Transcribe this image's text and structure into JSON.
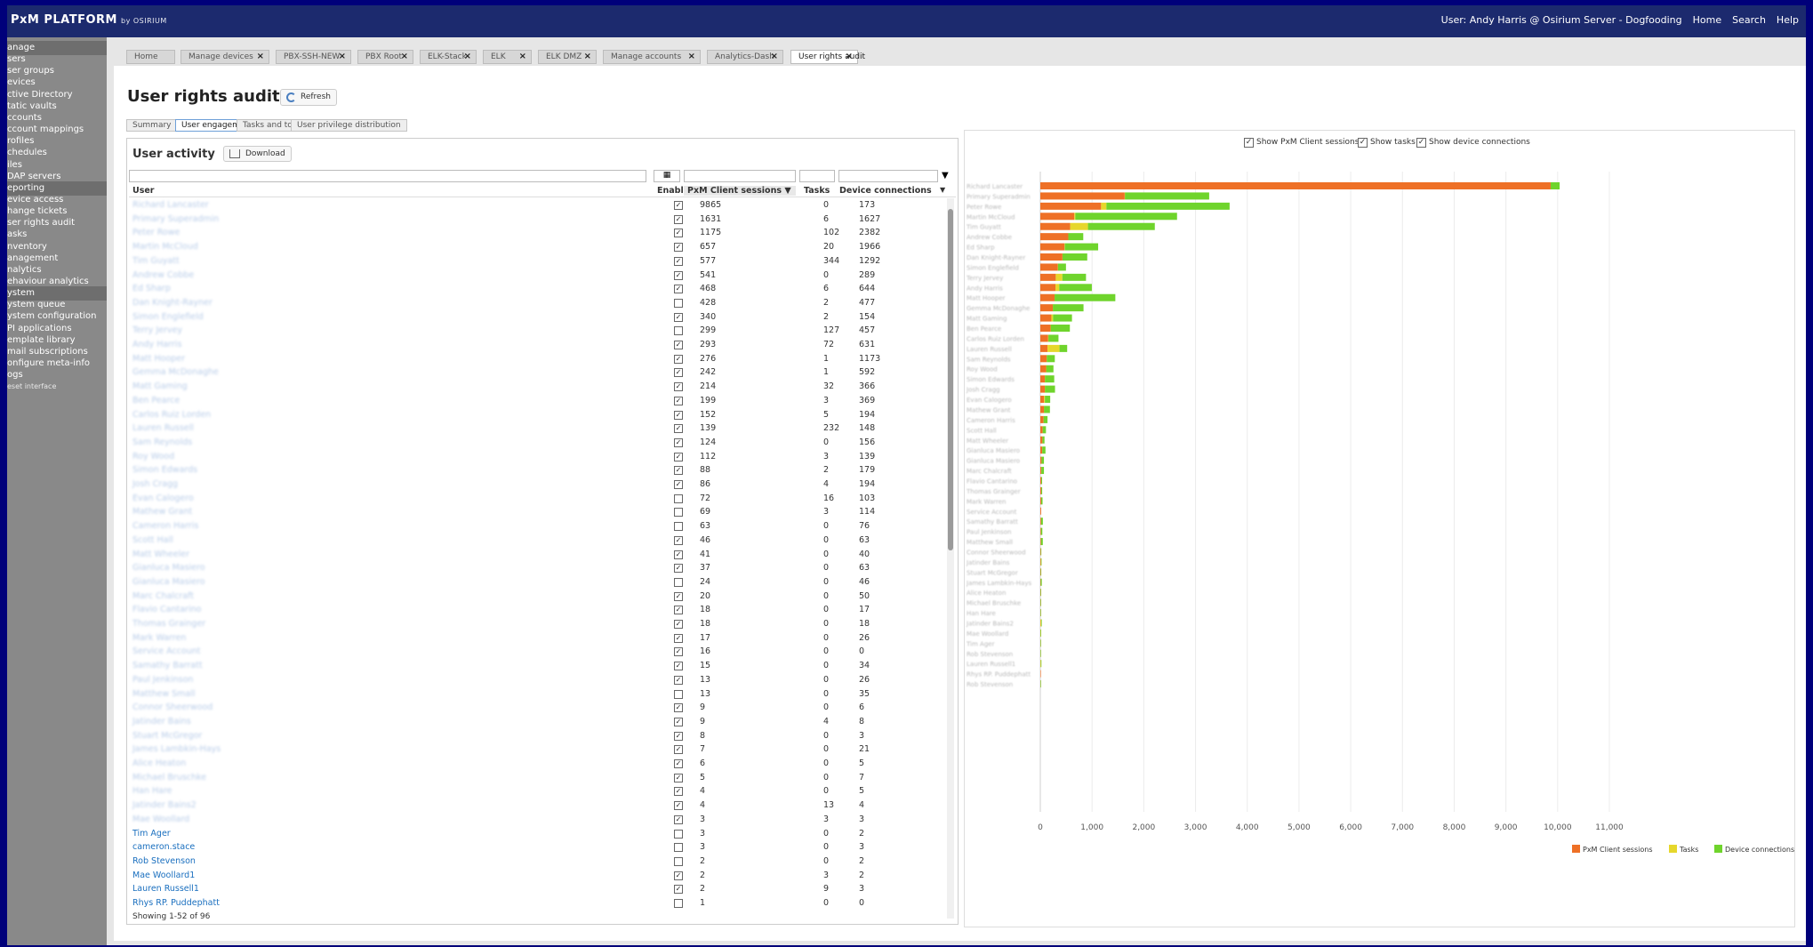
{
  "topbar": {
    "brand": "PxM PLATFORM",
    "brand_sub": "by OSIRIUM",
    "user": "User: Andy Harris @ Osirium Server - Dogfooding",
    "home": "Home",
    "search": "Search",
    "help": "Help"
  },
  "sidebar": [
    {
      "label": "anage",
      "type": "section"
    },
    {
      "label": "sers",
      "arrow": true
    },
    {
      "label": "ser groups",
      "arrow": true
    },
    {
      "label": "evices",
      "arrow": true
    },
    {
      "label": "ctive Directory",
      "arrow": true
    },
    {
      "label": "tatic vaults",
      "arrow": true
    },
    {
      "label": "ccounts"
    },
    {
      "label": "ccount mappings",
      "arrow": true
    },
    {
      "label": "rofiles",
      "arrow": true
    },
    {
      "label": "chedules",
      "arrow": true
    },
    {
      "label": "iles"
    },
    {
      "label": "DAP servers",
      "arrow": true
    },
    {
      "label": "eporting",
      "type": "section"
    },
    {
      "label": "evice access"
    },
    {
      "label": "hange tickets"
    },
    {
      "label": "ser rights audit"
    },
    {
      "label": "asks"
    },
    {
      "label": "nventory"
    },
    {
      "label": "anagement"
    },
    {
      "label": "nalytics"
    },
    {
      "label": "ehaviour analytics"
    },
    {
      "label": "ystem",
      "type": "section"
    },
    {
      "label": "ystem queue",
      "arrow": true
    },
    {
      "label": "ystem configuration"
    },
    {
      "label": "PI applications"
    },
    {
      "label": "emplate library"
    },
    {
      "label": "mail subscriptions"
    },
    {
      "label": "onfigure meta-info"
    },
    {
      "label": "ogs"
    },
    {
      "label": "eset interface",
      "type": "small"
    }
  ],
  "tabs": [
    {
      "label": "Home",
      "closable": false
    },
    {
      "label": "Manage devices",
      "closable": true
    },
    {
      "label": "PBX-SSH-NEW",
      "closable": true
    },
    {
      "label": "PBX Root",
      "closable": true
    },
    {
      "label": "ELK-Stack",
      "closable": true
    },
    {
      "label": "ELK",
      "closable": true
    },
    {
      "label": "ELK DMZ",
      "closable": true
    },
    {
      "label": "Manage accounts",
      "closable": true
    },
    {
      "label": "Analytics-Dash",
      "closable": true
    },
    {
      "label": "User rights audit",
      "closable": true,
      "active": true
    }
  ],
  "page": {
    "title": "User rights audit",
    "refresh_label": "Refresh"
  },
  "subtabs": [
    {
      "label": "Summary"
    },
    {
      "label": "User engagement",
      "active": true
    },
    {
      "label": "Tasks and tools"
    },
    {
      "label": "User privilege distribution"
    }
  ],
  "activity": {
    "title": "User activity",
    "download_label": "Download",
    "showing": "Showing 1-52 of 96"
  },
  "columns": {
    "user": "User",
    "enabled": "Enabled",
    "sessions": "PxM Client sessions",
    "tasks": "Tasks",
    "device": "Device connections"
  },
  "rows": [
    {
      "user": "Richard Lancaster",
      "enabled": true,
      "sessions": 9865,
      "tasks": 0,
      "device": 173
    },
    {
      "user": "Primary Superadmin",
      "enabled": true,
      "sessions": 1631,
      "tasks": 6,
      "device": 1627
    },
    {
      "user": "Peter Rowe",
      "enabled": true,
      "sessions": 1175,
      "tasks": 102,
      "device": 2382
    },
    {
      "user": "Martin McCloud",
      "enabled": true,
      "sessions": 657,
      "tasks": 20,
      "device": 1966
    },
    {
      "user": "Tim Guyatt",
      "enabled": true,
      "sessions": 577,
      "tasks": 344,
      "device": 1292
    },
    {
      "user": "Andrew Cobbe",
      "enabled": true,
      "sessions": 541,
      "tasks": 0,
      "device": 289
    },
    {
      "user": "Ed Sharp",
      "enabled": true,
      "sessions": 468,
      "tasks": 6,
      "device": 644
    },
    {
      "user": "Dan Knight-Rayner",
      "enabled": false,
      "sessions": 428,
      "tasks": 2,
      "device": 477
    },
    {
      "user": "Simon Englefield",
      "enabled": true,
      "sessions": 340,
      "tasks": 2,
      "device": 154
    },
    {
      "user": "Terry Jervey",
      "enabled": false,
      "sessions": 299,
      "tasks": 127,
      "device": 457
    },
    {
      "user": "Andy Harris",
      "enabled": true,
      "sessions": 293,
      "tasks": 72,
      "device": 631
    },
    {
      "user": "Matt Hooper",
      "enabled": true,
      "sessions": 276,
      "tasks": 1,
      "device": 1173
    },
    {
      "user": "Gemma McDonaghe",
      "enabled": true,
      "sessions": 242,
      "tasks": 1,
      "device": 592
    },
    {
      "user": "Matt Gaming",
      "enabled": true,
      "sessions": 214,
      "tasks": 32,
      "device": 366
    },
    {
      "user": "Ben Pearce",
      "enabled": true,
      "sessions": 199,
      "tasks": 3,
      "device": 369
    },
    {
      "user": "Carlos Ruiz Lorden",
      "enabled": true,
      "sessions": 152,
      "tasks": 5,
      "device": 194
    },
    {
      "user": "Lauren Russell",
      "enabled": true,
      "sessions": 139,
      "tasks": 232,
      "device": 148
    },
    {
      "user": "Sam Reynolds",
      "enabled": true,
      "sessions": 124,
      "tasks": 0,
      "device": 156
    },
    {
      "user": "Roy Wood",
      "enabled": true,
      "sessions": 112,
      "tasks": 3,
      "device": 139
    },
    {
      "user": "Simon Edwards",
      "enabled": true,
      "sessions": 88,
      "tasks": 2,
      "device": 179
    },
    {
      "user": "Josh Cragg",
      "enabled": true,
      "sessions": 86,
      "tasks": 4,
      "device": 194
    },
    {
      "user": "Evan Calogero",
      "enabled": false,
      "sessions": 72,
      "tasks": 16,
      "device": 103
    },
    {
      "user": "Mathew Grant",
      "enabled": false,
      "sessions": 69,
      "tasks": 3,
      "device": 114
    },
    {
      "user": "Cameron Harris",
      "enabled": false,
      "sessions": 63,
      "tasks": 0,
      "device": 76
    },
    {
      "user": "Scott Hall",
      "enabled": true,
      "sessions": 46,
      "tasks": 0,
      "device": 63
    },
    {
      "user": "Matt Wheeler",
      "enabled": true,
      "sessions": 41,
      "tasks": 0,
      "device": 40
    },
    {
      "user": "Gianluca Masiero",
      "enabled": true,
      "sessions": 37,
      "tasks": 0,
      "device": 63
    },
    {
      "user": "Gianluca Masiero",
      "enabled": false,
      "sessions": 24,
      "tasks": 0,
      "device": 46
    },
    {
      "user": "Marc Chalcraft",
      "enabled": true,
      "sessions": 20,
      "tasks": 0,
      "device": 50
    },
    {
      "user": "Flavio Cantarino",
      "enabled": true,
      "sessions": 18,
      "tasks": 0,
      "device": 17
    },
    {
      "user": "Thomas Grainger",
      "enabled": true,
      "sessions": 18,
      "tasks": 0,
      "device": 18
    },
    {
      "user": "Mark Warren",
      "enabled": true,
      "sessions": 17,
      "tasks": 0,
      "device": 26
    },
    {
      "user": "Service Account",
      "enabled": true,
      "sessions": 16,
      "tasks": 0,
      "device": 0
    },
    {
      "user": "Samathy Barratt",
      "enabled": true,
      "sessions": 15,
      "tasks": 0,
      "device": 34
    },
    {
      "user": "Paul Jenkinson",
      "enabled": true,
      "sessions": 13,
      "tasks": 0,
      "device": 26
    },
    {
      "user": "Matthew Small",
      "enabled": false,
      "sessions": 13,
      "tasks": 0,
      "device": 35
    },
    {
      "user": "Connor Sheerwood",
      "enabled": true,
      "sessions": 9,
      "tasks": 0,
      "device": 6
    },
    {
      "user": "Jatinder Bains",
      "enabled": true,
      "sessions": 9,
      "tasks": 4,
      "device": 8
    },
    {
      "user": "Stuart McGregor",
      "enabled": true,
      "sessions": 8,
      "tasks": 0,
      "device": 3
    },
    {
      "user": "James Lambkin-Hays",
      "enabled": true,
      "sessions": 7,
      "tasks": 0,
      "device": 21
    },
    {
      "user": "Alice Heaton",
      "enabled": true,
      "sessions": 6,
      "tasks": 0,
      "device": 5
    },
    {
      "user": "Michael Bruschke",
      "enabled": true,
      "sessions": 5,
      "tasks": 0,
      "device": 7
    },
    {
      "user": "Han Hare",
      "enabled": true,
      "sessions": 4,
      "tasks": 0,
      "device": 5
    },
    {
      "user": "Jatinder Bains2",
      "enabled": true,
      "sessions": 4,
      "tasks": 13,
      "device": 4
    },
    {
      "user": "Mae Woollard",
      "enabled": true,
      "sessions": 3,
      "tasks": 3,
      "device": 3
    },
    {
      "user": "Tim Ager",
      "enabled": false,
      "sessions": 3,
      "tasks": 0,
      "device": 2
    },
    {
      "user": "cameron.stace",
      "enabled": false,
      "sessions": 3,
      "tasks": 0,
      "device": 3
    },
    {
      "user": "Rob Stevenson",
      "enabled": false,
      "sessions": 2,
      "tasks": 0,
      "device": 2
    },
    {
      "user": "Mae Woollard1",
      "enabled": true,
      "sessions": 2,
      "tasks": 3,
      "device": 2
    },
    {
      "user": "Lauren Russell1",
      "enabled": true,
      "sessions": 2,
      "tasks": 9,
      "device": 3
    },
    {
      "user": "Rhys RP. Puddephatt",
      "enabled": false,
      "sessions": 1,
      "tasks": 0,
      "device": 0
    }
  ],
  "chart_options": [
    {
      "label": "Show PxM Client sessions",
      "checked": true
    },
    {
      "label": "Show tasks",
      "checked": true
    },
    {
      "label": "Show device connections",
      "checked": true
    }
  ],
  "chart_data": {
    "type": "bar",
    "orientation": "horizontal",
    "stacked": true,
    "categories": [
      "Richard Lancaster",
      "Primary Superadmin",
      "Peter Rowe",
      "Martin McCloud",
      "Tim Guyatt",
      "Andrew Cobbe",
      "Ed Sharp",
      "Dan Knight-Rayner",
      "Simon Englefield",
      "Terry Jervey",
      "Andy Harris",
      "Matt Hooper",
      "Gemma McDonaghe",
      "Matt Gaming",
      "Ben Pearce",
      "Carlos Ruiz Lorden",
      "Lauren Russell",
      "Sam Reynolds",
      "Roy Wood",
      "Simon Edwards",
      "Josh Cragg",
      "Evan Calogero",
      "Mathew Grant",
      "Cameron Harris",
      "Scott Hall",
      "Matt Wheeler",
      "Gianluca Masiero",
      "Gianluca Masiero",
      "Marc Chalcraft",
      "Flavio Cantarino",
      "Thomas Grainger",
      "Mark Warren",
      "Service Account",
      "Samathy Barratt",
      "Paul Jenkinson",
      "Matthew Small",
      "Connor Sheerwood",
      "Jatinder Bains",
      "Stuart McGregor",
      "James Lambkin-Hays",
      "Alice Heaton",
      "Michael Bruschke",
      "Han Hare",
      "Jatinder Bains2",
      "Mae Woollard",
      "Tim Ager",
      "Rob Stevenson",
      "Lauren Russell1",
      "Rhys RP. Puddephatt",
      "Rob Stevenson"
    ],
    "series": [
      {
        "name": "PxM Client sessions",
        "color": "#ee7026",
        "values": [
          9865,
          1631,
          1175,
          657,
          577,
          541,
          468,
          428,
          340,
          299,
          293,
          276,
          242,
          214,
          199,
          152,
          139,
          124,
          112,
          88,
          86,
          72,
          69,
          63,
          46,
          41,
          37,
          24,
          20,
          18,
          18,
          17,
          16,
          15,
          13,
          13,
          9,
          9,
          8,
          7,
          6,
          5,
          4,
          4,
          3,
          3,
          2,
          2,
          1,
          2
        ]
      },
      {
        "name": "Tasks",
        "color": "#e6d72c",
        "values": [
          0,
          6,
          102,
          20,
          344,
          0,
          6,
          2,
          2,
          127,
          72,
          1,
          1,
          32,
          3,
          5,
          232,
          0,
          3,
          2,
          4,
          16,
          3,
          0,
          0,
          0,
          0,
          0,
          0,
          0,
          0,
          0,
          0,
          0,
          0,
          0,
          0,
          4,
          0,
          0,
          0,
          0,
          0,
          13,
          3,
          0,
          0,
          9,
          0,
          0
        ]
      },
      {
        "name": "Device connections",
        "color": "#6fd42c",
        "values": [
          173,
          1627,
          2382,
          1966,
          1292,
          289,
          644,
          477,
          154,
          457,
          631,
          1173,
          592,
          366,
          369,
          194,
          148,
          156,
          139,
          179,
          194,
          103,
          114,
          76,
          63,
          40,
          63,
          46,
          50,
          17,
          18,
          26,
          0,
          34,
          26,
          35,
          6,
          8,
          3,
          21,
          5,
          7,
          5,
          4,
          3,
          2,
          2,
          3,
          0,
          2
        ]
      }
    ],
    "xlim": [
      0,
      11000
    ],
    "xticks": [
      "0",
      "1,000",
      "2,000",
      "3,000",
      "4,000",
      "5,000",
      "6,000",
      "7,000",
      "8,000",
      "9,000",
      "10,000",
      "11,000"
    ],
    "legend": "bottom-right",
    "grid": true
  }
}
